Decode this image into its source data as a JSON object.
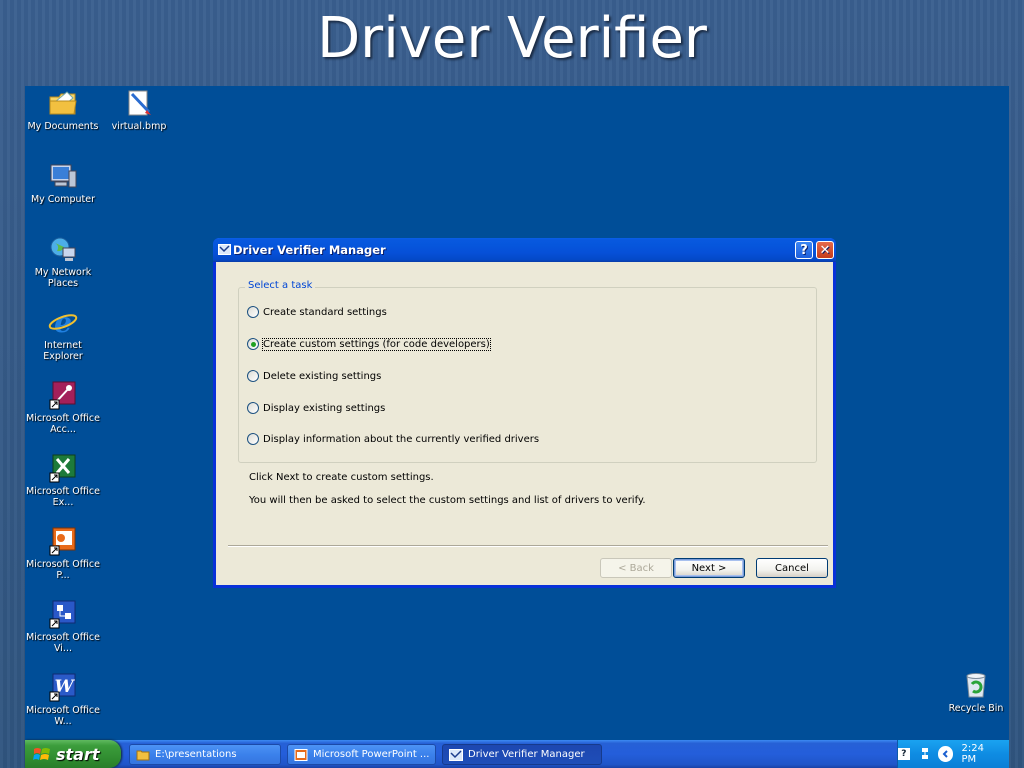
{
  "slide": {
    "title": "Driver Verifier"
  },
  "desktop": {
    "icons": [
      {
        "name": "My Documents"
      },
      {
        "name": "virtual.bmp"
      },
      {
        "name": "My Computer"
      },
      {
        "name": "My Network Places"
      },
      {
        "name": "Internet Explorer"
      },
      {
        "name": "Microsoft Office Acc..."
      },
      {
        "name": "Microsoft Office Ex..."
      },
      {
        "name": "Microsoft Office P..."
      },
      {
        "name": "Microsoft Office Vi..."
      },
      {
        "name": "Microsoft Office W..."
      },
      {
        "name": "Recycle Bin"
      }
    ]
  },
  "dialog": {
    "title": "Driver Verifier Manager",
    "help_glyph": "?",
    "close_glyph": "✕",
    "group_label": "Select a task",
    "options": [
      {
        "label": "Create standard settings",
        "selected": false
      },
      {
        "label": "Create custom settings (for code developers)",
        "selected": true
      },
      {
        "label": "Delete existing settings",
        "selected": false
      },
      {
        "label": "Display existing settings",
        "selected": false
      },
      {
        "label": "Display information about the currently verified drivers",
        "selected": false
      }
    ],
    "info_line1": "Click Next to create custom settings.",
    "info_line2": "You will then be asked to select the custom settings and list of drivers to verify.",
    "back_label": "< Back",
    "next_label": "Next >",
    "cancel_label": "Cancel"
  },
  "taskbar": {
    "start_label": "start",
    "tasks": [
      {
        "label": "E:\\presentations",
        "active": false
      },
      {
        "label": "Microsoft PowerPoint ...",
        "active": false
      },
      {
        "label": "Driver Verifier Manager",
        "active": true
      }
    ],
    "clock": "2:24 PM"
  },
  "colors": {
    "desktop_bg": "#004e98",
    "titlebar_blue": "#0656dc",
    "dialog_face": "#ece9d8",
    "start_green": "#3c9d3c",
    "tray_blue": "#0f8ce3"
  }
}
